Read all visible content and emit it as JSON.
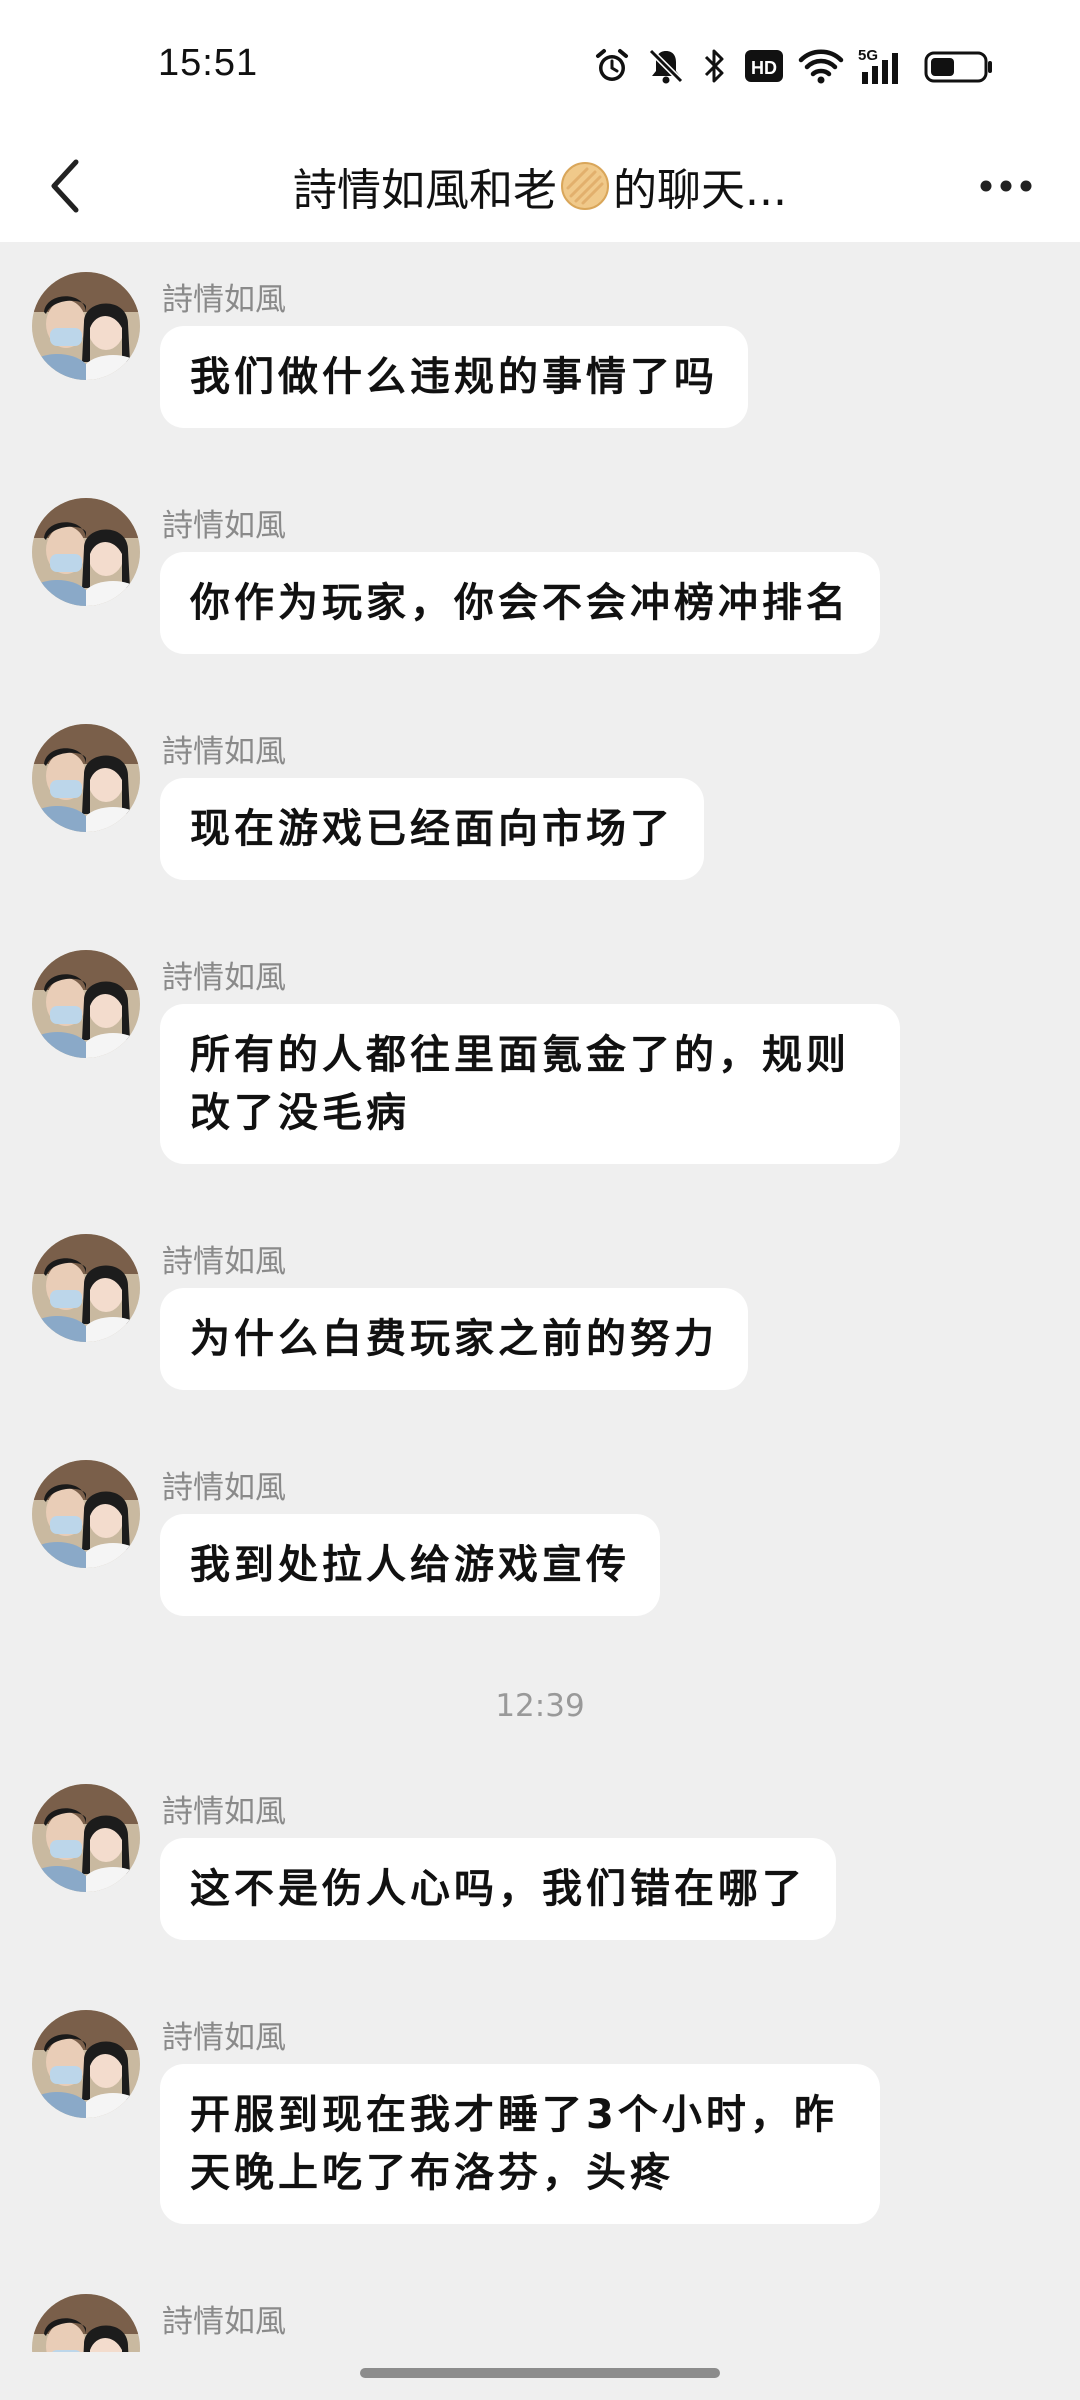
{
  "status_bar": {
    "time": "15:51",
    "icons": [
      "alarm-icon",
      "mute-icon",
      "bluetooth-icon",
      "hd-icon",
      "wifi-icon",
      "5g-signal-icon",
      "battery-icon"
    ],
    "hd_label": "HD",
    "network_label": "5G",
    "battery_level": 0.45
  },
  "header": {
    "title_before_emoji": "詩情如風和老",
    "title_after_emoji": "的聊天...",
    "emoji": "cookie-emoji",
    "back_icon": "chevron-left-icon",
    "more_icon": "more-dots-icon"
  },
  "messages": [
    {
      "sender": "詩情如風",
      "text": "我们做什么违规的事情了吗"
    },
    {
      "sender": "詩情如風",
      "text": "你作为玩家，你会不会冲榜冲排名"
    },
    {
      "sender": "詩情如風",
      "text": "现在游戏已经面向市场了"
    },
    {
      "sender": "詩情如風",
      "text": "所有的人都往里面氪金了的，规则改了没毛病"
    },
    {
      "sender": "詩情如風",
      "text": "为什么白费玩家之前的努力"
    },
    {
      "sender": "詩情如風",
      "text": "我到处拉人给游戏宣传"
    },
    {
      "sender": "詩情如風",
      "text": "这不是伤人心吗，我们错在哪了"
    },
    {
      "sender": "詩情如風",
      "text": "开服到现在我才睡了3个小时，昨天晚上吃了布洛芬，头疼"
    },
    {
      "sender": "詩情如風",
      "text": ""
    }
  ],
  "timestamp": "12:39",
  "colors": {
    "background": "#efefef",
    "bubble": "#ffffff",
    "sender": "#8a8a8a",
    "text": "#111111"
  }
}
